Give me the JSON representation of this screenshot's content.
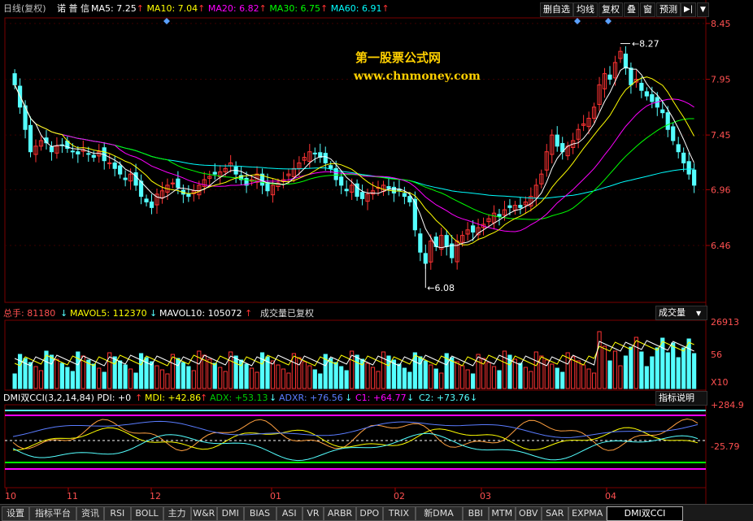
{
  "header": {
    "period": "日线(复权)",
    "stock": "诺 普 信",
    "ma": [
      {
        "label": "MA5: 7.25",
        "arrow": "↑",
        "color": "#ffffff"
      },
      {
        "label": "MA10: 7.04",
        "arrow": "↑",
        "color": "#ffff00"
      },
      {
        "label": "MA20: 6.82",
        "arrow": "↑",
        "color": "#ff00ff"
      },
      {
        "label": "MA30: 6.75",
        "arrow": "↑",
        "color": "#00ff00"
      },
      {
        "label": "MA60: 6.91",
        "arrow": "↑",
        "color": "#00ffff"
      }
    ],
    "buttons": [
      "删自选",
      "均线",
      "复权",
      "叠",
      "窗",
      "预测"
    ],
    "nav_icon": "play-end-icon",
    "menu_icon": "dropdown-icon"
  },
  "watermark": {
    "line1": "第一股票公式网",
    "line2": "www.chnmoney.com"
  },
  "price_axis": {
    "labels": [
      "8.45",
      "7.95",
      "7.45",
      "6.96",
      "6.46"
    ]
  },
  "annotations": {
    "high": "8.27",
    "low": "6.08"
  },
  "volume": {
    "title": "总手: 81180",
    "mavol5": "MAVOL5: 112370",
    "mavol10": "MAVOL10: 105072",
    "note": "成交量已复权",
    "selector": "成交量",
    "axis": [
      "26913",
      "56",
      "X10"
    ]
  },
  "indicator": {
    "title": "DMI双CCI(3,2,14,84) PDI: +0",
    "mdi": "MDI: +42.86",
    "adx": "ADX: +53.13",
    "adxr": "ADXR: +76.56",
    "c1": "C1: +64.77",
    "c2": "C2: +73.76",
    "help": "指标说明",
    "axis": [
      "+284.9",
      "-25.79"
    ]
  },
  "months": [
    "10",
    "11",
    "12",
    "01",
    "02",
    "03",
    "04"
  ],
  "tabs": [
    "设置",
    "指标平台",
    "资讯",
    "RSI",
    "BOLL",
    "主力",
    "W&R",
    "DMI",
    "BIAS",
    "ASI",
    "VR",
    "ARBR",
    "DPO",
    "TRIX",
    "新DMA",
    "BBI",
    "MTM",
    "OBV",
    "SAR",
    "EXPMA",
    "DMI双CCI"
  ],
  "active_tab": "DMI双CCI",
  "colors": {
    "up": "#ff3333",
    "down": "#54ffff",
    "grid": "#7a0000",
    "ma5": "#ffffff",
    "ma10": "#ffff00",
    "ma20": "#ff00ff",
    "ma30": "#00ff00",
    "ma60": "#00ffff"
  },
  "chart_data": {
    "type": "candlestick",
    "y_range": [
      5.95,
      8.5
    ],
    "closes": [
      7.9,
      7.7,
      7.5,
      7.3,
      7.35,
      7.4,
      7.38,
      7.3,
      7.35,
      7.36,
      7.33,
      7.3,
      7.28,
      7.32,
      7.28,
      7.25,
      7.3,
      7.22,
      7.2,
      7.15,
      7.1,
      7.05,
      7.1,
      7.0,
      6.9,
      6.85,
      6.8,
      6.92,
      6.95,
      7.0,
      7.02,
      6.98,
      6.92,
      6.9,
      6.95,
      7.0,
      7.05,
      7.08,
      7.1,
      7.12,
      7.15,
      7.2,
      7.1,
      7.05,
      7.0,
      7.05,
      7.1,
      7.0,
      6.95,
      7.0,
      7.02,
      7.05,
      7.1,
      7.15,
      7.2,
      7.25,
      7.3,
      7.28,
      7.25,
      7.2,
      7.15,
      7.05,
      7.0,
      6.95,
      7.0,
      6.9,
      6.88,
      6.92,
      6.95,
      6.98,
      7.0,
      6.97,
      6.93,
      6.95,
      6.9,
      6.85,
      6.6,
      6.4,
      6.3,
      6.5,
      6.45,
      6.55,
      6.45,
      6.35,
      6.5,
      6.55,
      6.6,
      6.58,
      6.62,
      6.65,
      6.7,
      6.75,
      6.72,
      6.78,
      6.8,
      6.82,
      6.8,
      6.85,
      6.9,
      7.0,
      7.1,
      7.3,
      7.45,
      7.35,
      7.3,
      7.35,
      7.4,
      7.5,
      7.55,
      7.6,
      7.7,
      7.9,
      8.0,
      7.95,
      8.1,
      8.2,
      8.05,
      7.9,
      7.95,
      7.85,
      7.8,
      7.75,
      7.7,
      7.65,
      7.5,
      7.4,
      7.3,
      7.2,
      7.1,
      7.0
    ],
    "high": 8.27,
    "low": 6.08,
    "volume_range": [
      0,
      26913
    ]
  }
}
